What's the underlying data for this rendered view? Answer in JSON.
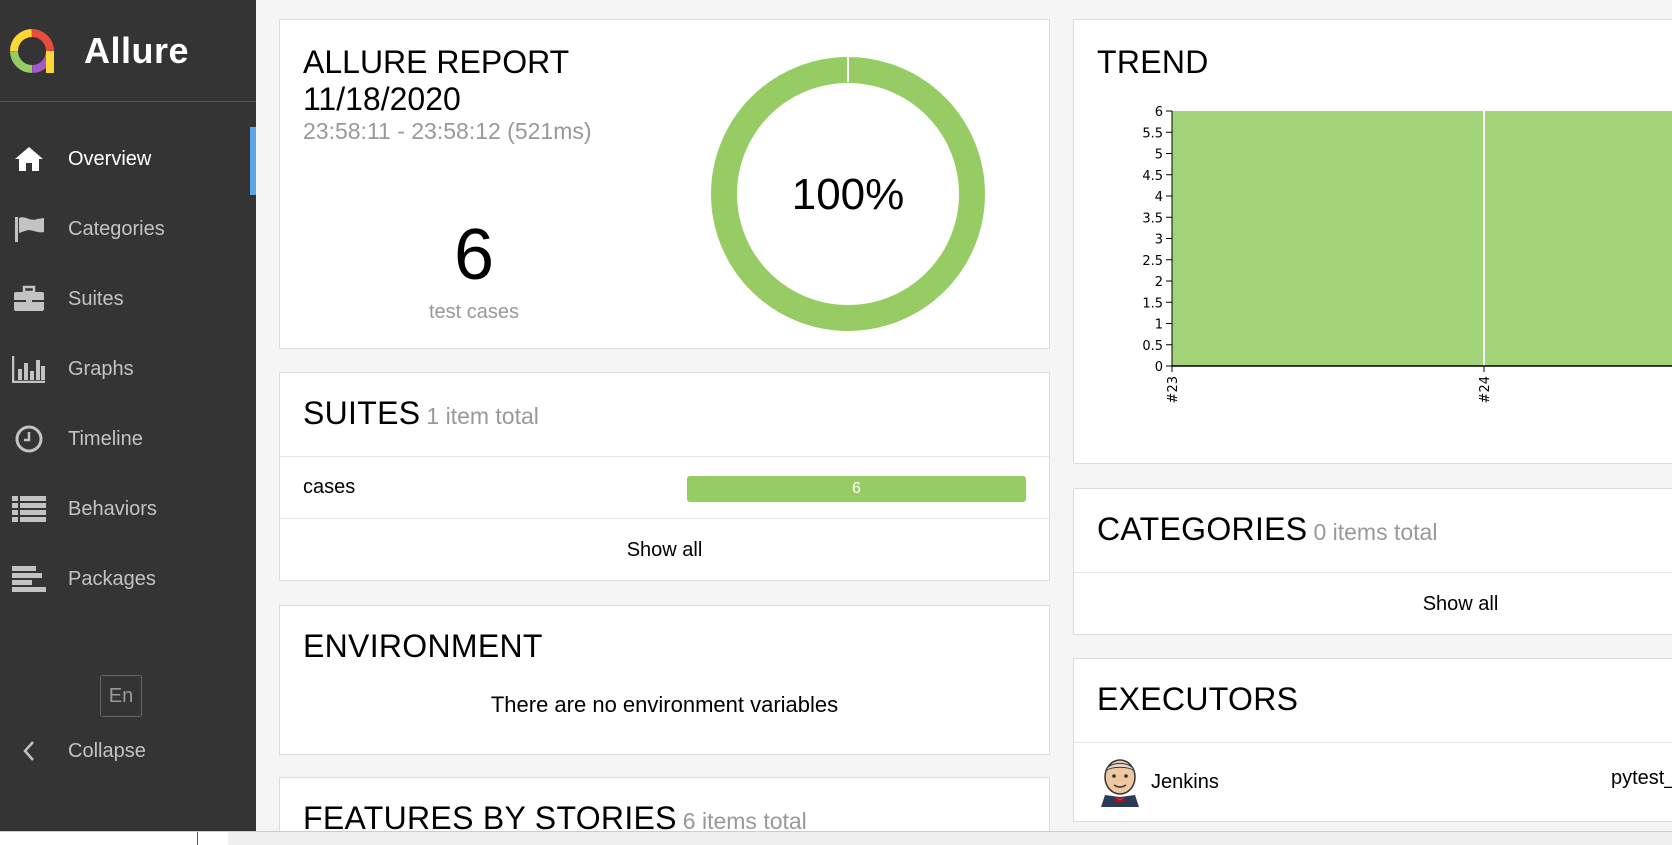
{
  "brand": {
    "name": "Allure"
  },
  "sidebar": {
    "items": [
      {
        "label": "Overview",
        "icon": "home-icon",
        "active": true
      },
      {
        "label": "Categories",
        "icon": "flag-icon",
        "active": false
      },
      {
        "label": "Suites",
        "icon": "briefcase-icon",
        "active": false
      },
      {
        "label": "Graphs",
        "icon": "bar-chart-icon",
        "active": false
      },
      {
        "label": "Timeline",
        "icon": "clock-icon",
        "active": false
      },
      {
        "label": "Behaviors",
        "icon": "list-icon",
        "active": false
      },
      {
        "label": "Packages",
        "icon": "align-left-icon",
        "active": false
      }
    ],
    "language": "En",
    "collapse_label": "Collapse"
  },
  "summary": {
    "title_line1": "ALLURE REPORT",
    "title_line2": "11/18/2020",
    "time_range": "23:58:11 - 23:58:12 (521ms)",
    "test_count": "6",
    "test_count_label": "test cases",
    "pass_percent": "100%",
    "pass_fraction": 1.0
  },
  "suites": {
    "title": "SUITES",
    "subtitle": "1 item total",
    "rows": [
      {
        "name": "cases",
        "count": "6"
      }
    ],
    "show_all": "Show all"
  },
  "environment": {
    "title": "ENVIRONMENT",
    "empty_text": "There are no environment variables"
  },
  "features": {
    "title": "FEATURES BY STORIES",
    "subtitle": "6 items total"
  },
  "trend": {
    "title": "TREND"
  },
  "categories": {
    "title": "CATEGORIES",
    "subtitle": "0 items total",
    "show_all": "Show all"
  },
  "executors": {
    "title": "EXECUTORS",
    "name": "Jenkins",
    "build": "pytest_"
  },
  "colors": {
    "passed": "#97cc64",
    "trend_fill": "#a4d47a",
    "sidebar_bg": "#343434",
    "active_accent": "#5ea7e6"
  },
  "chart_data": {
    "type": "area",
    "title": "TREND",
    "categories": [
      "#23",
      "#24"
    ],
    "series": [
      {
        "values": [
          6,
          6
        ]
      }
    ],
    "ylim": [
      0,
      6
    ],
    "yticks": [
      "0",
      "0.5",
      "1",
      "1.5",
      "2",
      "2.5",
      "3",
      "3.5",
      "4",
      "4.5",
      "5",
      "5.5",
      "6"
    ],
    "grid": false
  }
}
